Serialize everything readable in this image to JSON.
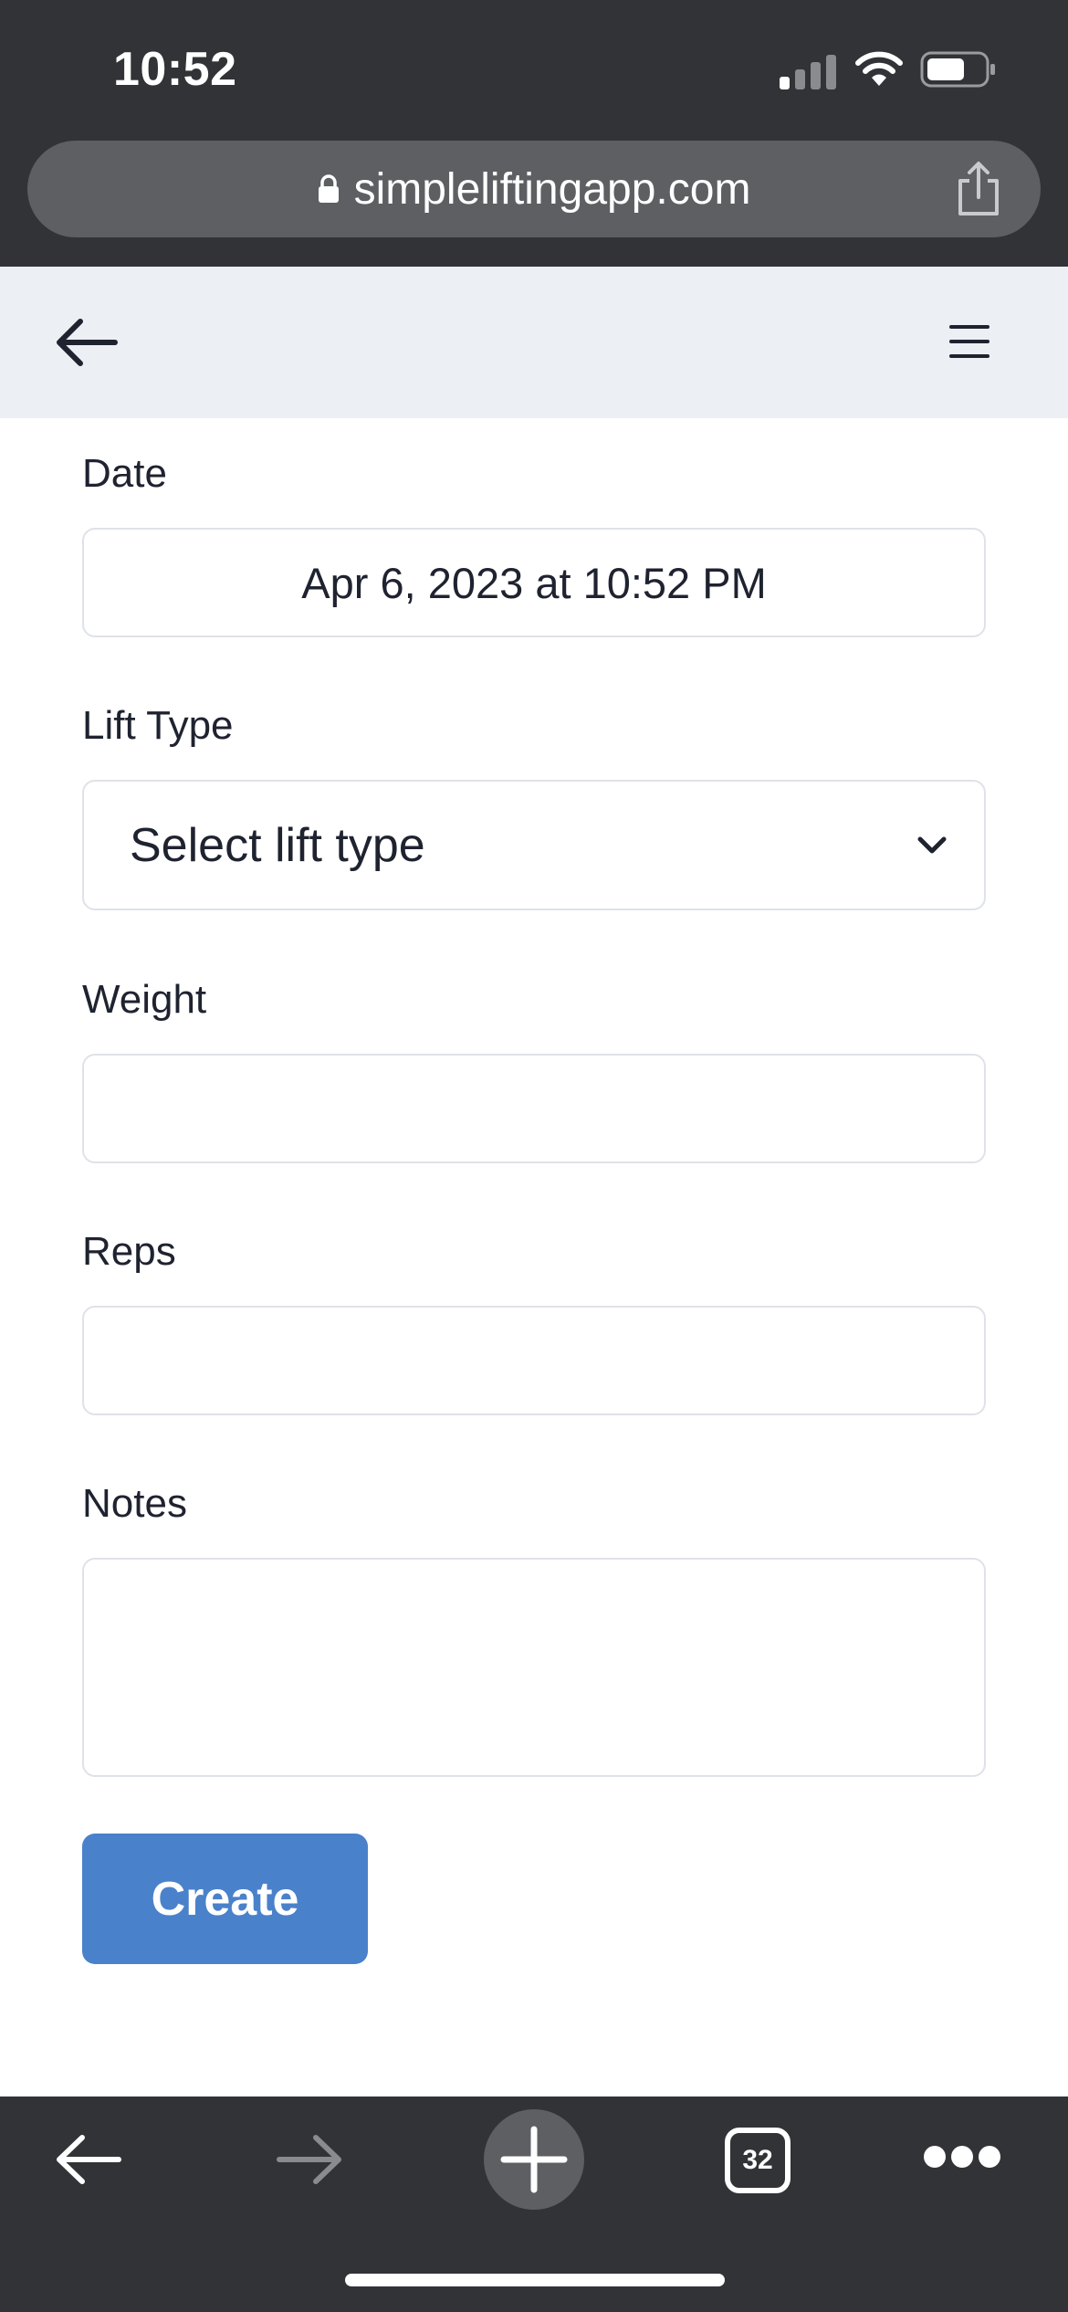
{
  "status_bar": {
    "time": "10:52"
  },
  "browser": {
    "url": "simpleliftingapp.com",
    "tab_count": "32"
  },
  "form": {
    "date": {
      "label": "Date",
      "value": "Apr 6, 2023 at 10:52 PM"
    },
    "lift_type": {
      "label": "Lift Type",
      "selected": "Select lift type"
    },
    "weight": {
      "label": "Weight",
      "value": ""
    },
    "reps": {
      "label": "Reps",
      "value": ""
    },
    "notes": {
      "label": "Notes",
      "value": ""
    },
    "submit_label": "Create"
  },
  "colors": {
    "browser_chrome": "#323336",
    "app_header": "#eceff4",
    "primary_button": "#4a81cb",
    "text": "#1f2330",
    "input_border": "#dfe2e8"
  }
}
